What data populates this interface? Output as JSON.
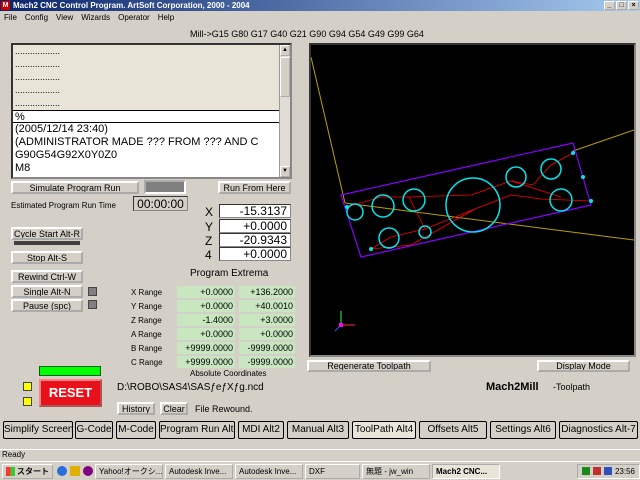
{
  "window": {
    "title": "Mach2 CNC Control Program. ArtSoft Corporation, 2000 - 2004",
    "app_icon": "M",
    "minimize": "_",
    "maximize": "□",
    "close": "×"
  },
  "menu": [
    "File",
    "Config",
    "View",
    "Wizards",
    "Operator",
    "Help"
  ],
  "modal_gcodes": "Mill->G15  G80 G17 G40 G21 G90 G94 G54 G49 G99 G64",
  "code": {
    "lines": [
      "..................",
      "..................",
      "..................",
      "..................",
      "..................",
      "%",
      "(2005/12/14 23:40)",
      "(ADMINISTRATOR MADE ??? FROM ??? AND C",
      "G90G54G92X0Y0Z0",
      "M8"
    ],
    "current_index": 5
  },
  "buttons": {
    "simulate": "Simulate Program Run",
    "run_from_here": "Run From Here",
    "cycle_start": "Cycle Start Alt-R",
    "stop": "Stop Alt-S",
    "rewind": "Rewind Ctrl-W",
    "single": "Single Alt-N",
    "pause": "Pause (spc)",
    "reset": "RESET",
    "history": "History",
    "clear": "Clear",
    "regenerate": "Regenerate Toolpath",
    "display_mode": "Display Mode"
  },
  "estimated": {
    "label": "Estimated Program Run Time",
    "value": "00:00:00"
  },
  "dro": [
    {
      "axis": "X",
      "value": "-15.3137"
    },
    {
      "axis": "Y",
      "value": "+0.0000"
    },
    {
      "axis": "Z",
      "value": "-20.9343"
    },
    {
      "axis": "4",
      "value": "+0.0000"
    }
  ],
  "extrema": {
    "title": "Program Extrema",
    "rows": [
      {
        "label": "X Range",
        "min": "+0.0000",
        "max": "+136.2000"
      },
      {
        "label": "Y Range",
        "min": "+0.0000",
        "max": "+40.0010"
      },
      {
        "label": "Z Range",
        "min": "-1.4000",
        "max": "+3.0000"
      },
      {
        "label": "A Range",
        "min": "+0.0000",
        "max": "+0.0000"
      },
      {
        "label": "B Range",
        "min": "+9999.0000",
        "max": "-9999.0000"
      },
      {
        "label": "C Range",
        "min": "+9999.0000",
        "max": "-9999.0000"
      }
    ],
    "footer": "Absolute Coordinates"
  },
  "file": {
    "path": "D:\\ROBO\\SAS4\\SASƒeƒXƒg.ncd",
    "status": "File Rewound."
  },
  "mach_label": "Mach2Mill",
  "toolpath_label": "-Toolpath",
  "tabs": [
    {
      "label": "Simplify Screen",
      "active": false
    },
    {
      "label": "G-Code",
      "active": false
    },
    {
      "label": "M-Code",
      "active": false
    },
    {
      "label": "Program Run Alt-1",
      "active": false
    },
    {
      "label": "MDI Alt2",
      "active": false
    },
    {
      "label": "Manual Alt3",
      "active": false
    },
    {
      "label": "ToolPath Alt4",
      "active": true
    },
    {
      "label": "Offsets Alt5",
      "active": false
    },
    {
      "label": "Settings Alt6",
      "active": false
    },
    {
      "label": "Diagnostics Alt-7",
      "active": false
    }
  ],
  "status": "Ready",
  "taskbar": {
    "start": "スタート",
    "tasks": [
      "Yahoo!オークシ...",
      "Autodesk Inve...",
      "Autodesk Inve...",
      "DXF",
      "無題 - jw_win",
      "Mach2 CNC..."
    ],
    "active_index": 5,
    "clock": "23:56"
  },
  "colors": {
    "title_bg": "#0a246a",
    "led_green": "#00ff00",
    "led_yellow": "#ffff00",
    "reset_red": "#e8101a",
    "tool_circle": "#00e5ee",
    "tool_boundary": "#8800ff",
    "tool_move": "#ff0000",
    "range_bg": "#c8e6c0"
  },
  "icons": [
    "mach-app-icon",
    "windows-start-icon",
    "ie-icon",
    "yahoo-icon",
    "autodesk-icon",
    "folder-icon",
    "jw-icon",
    "mach-task-icon",
    "axis-gizmo-icon"
  ]
}
